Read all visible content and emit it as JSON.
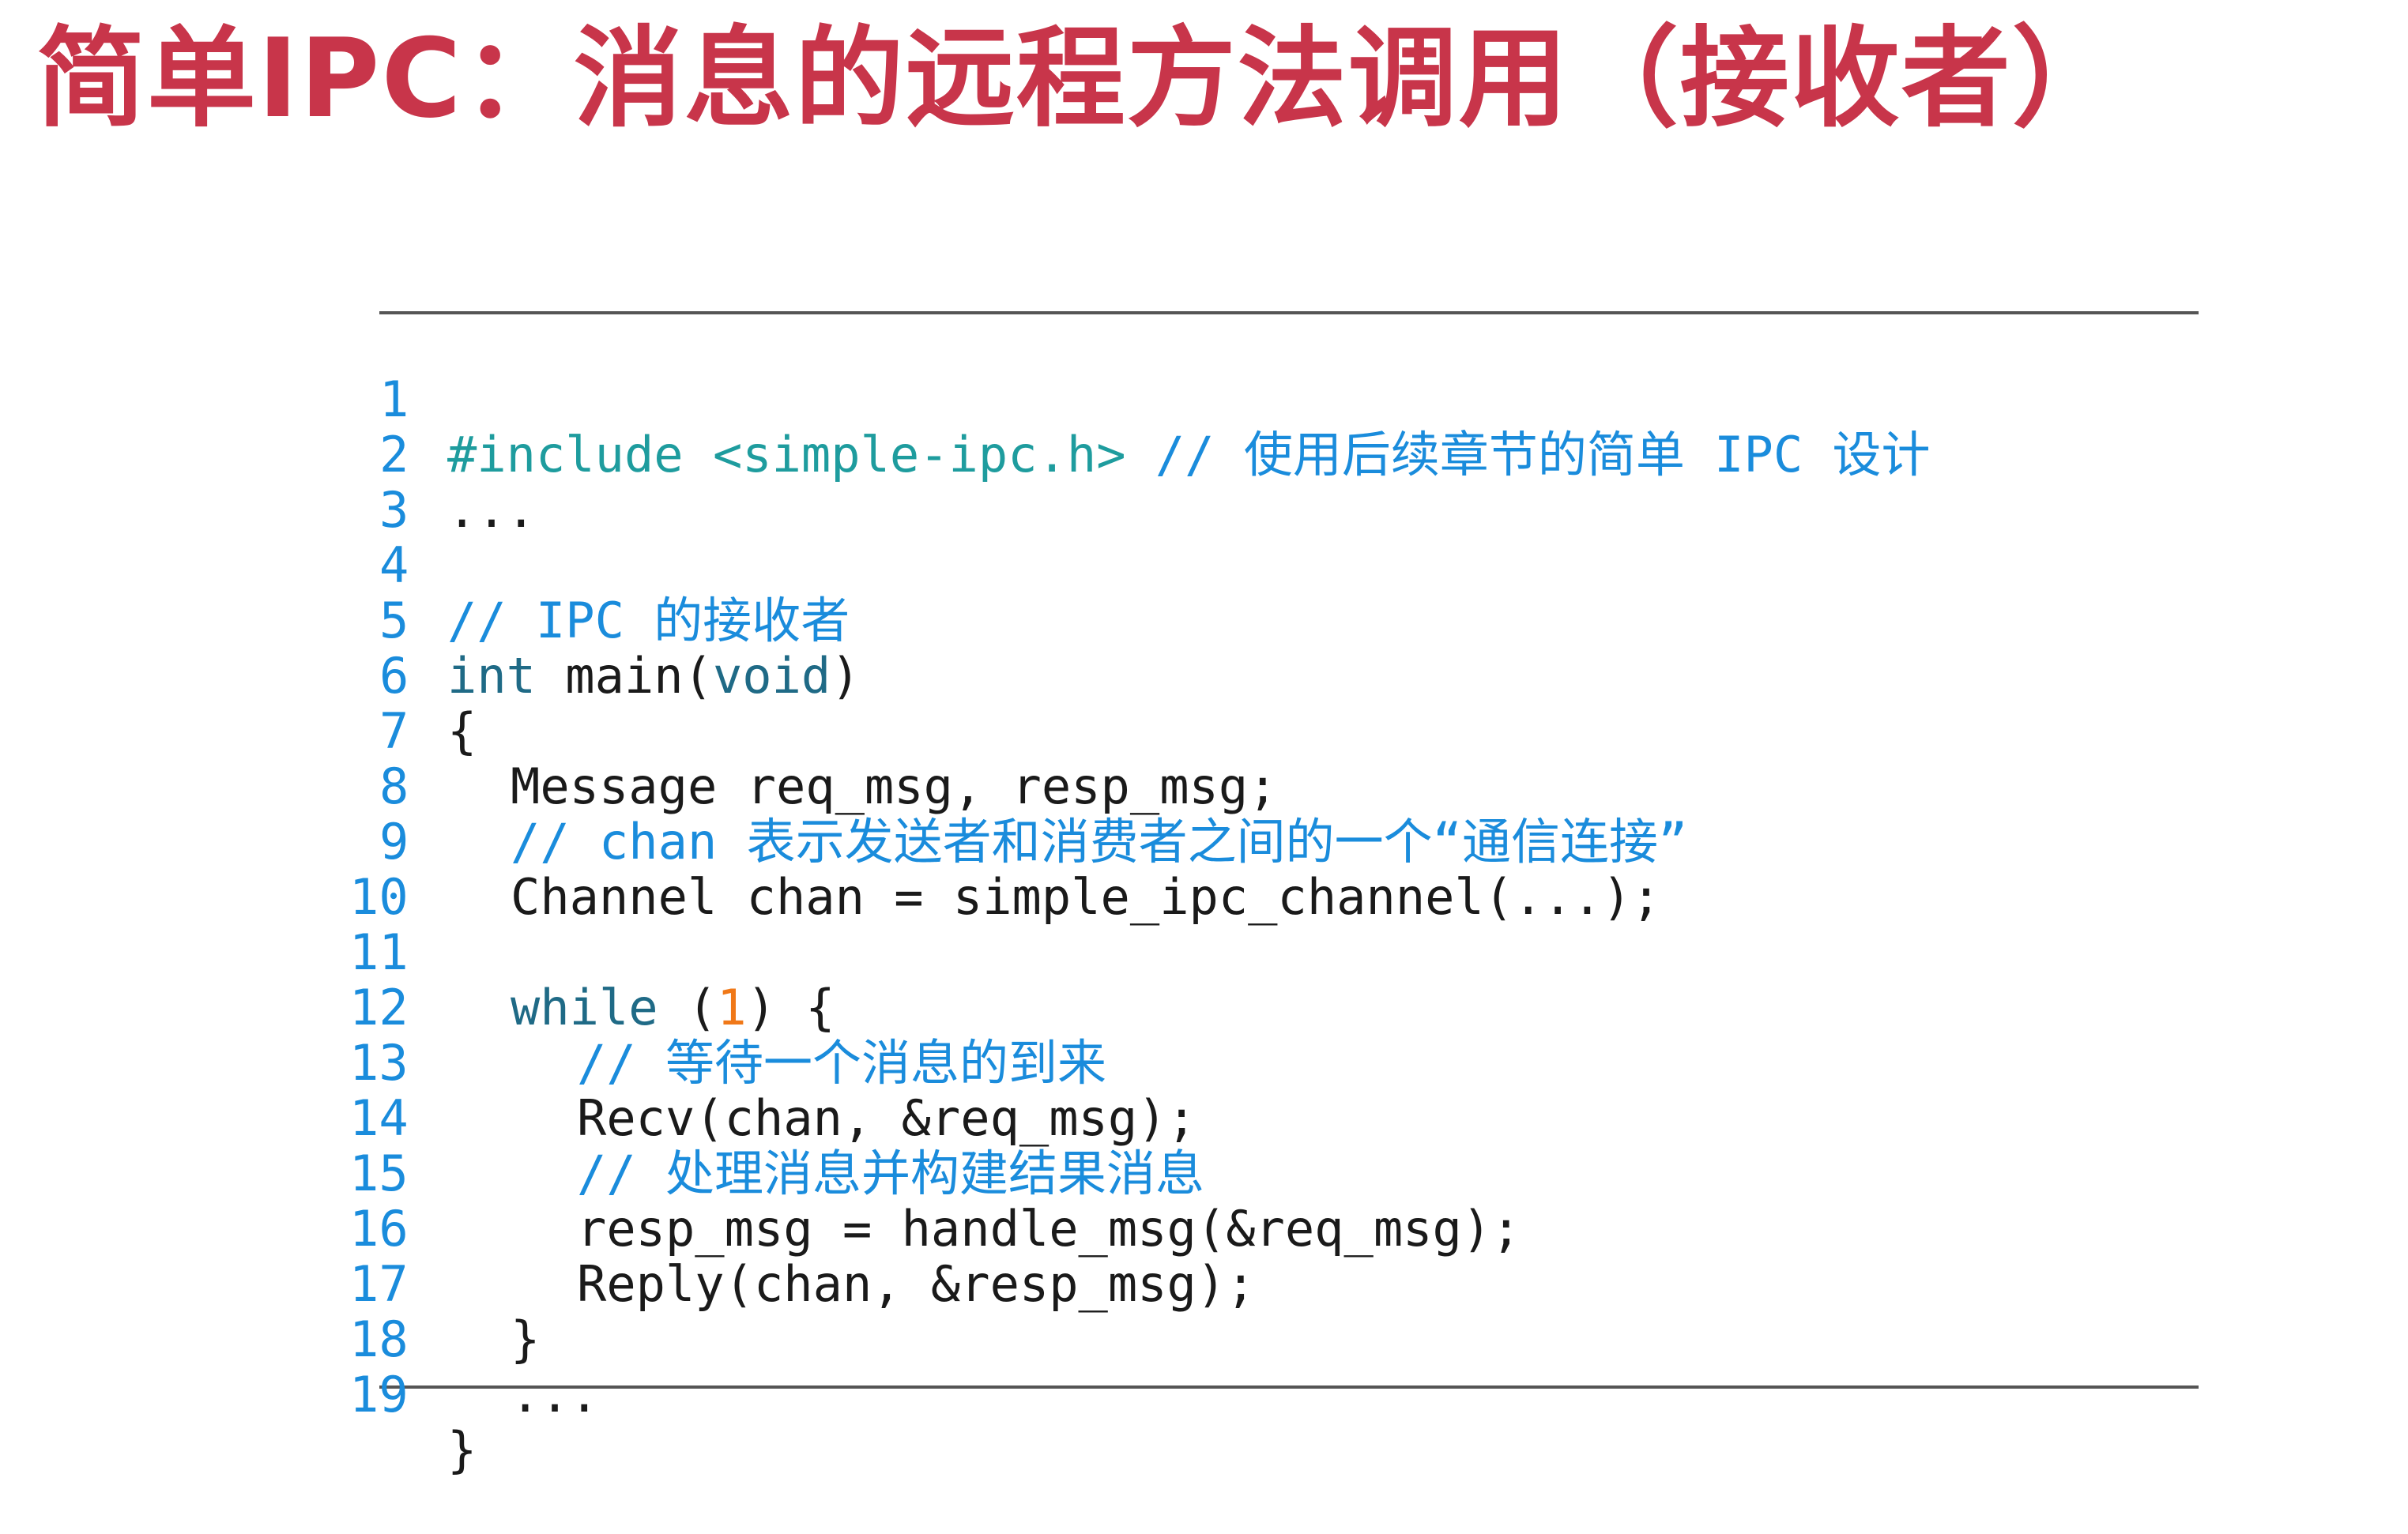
{
  "slide": {
    "title": "简单IPC：消息的远程方法调用（接收者）"
  },
  "code": {
    "lines": [
      {
        "no": "1",
        "parts": [
          "#include <simple-ipc.h>",
          " ",
          "// 使用后续章节的简单 IPC 设计"
        ]
      },
      {
        "no": "2",
        "parts": [
          "..."
        ]
      },
      {
        "no": "3",
        "parts": []
      },
      {
        "no": "4",
        "parts": [
          "// IPC 的接收者"
        ]
      },
      {
        "no": "5",
        "parts": [
          "int",
          " main(",
          "void",
          ")"
        ]
      },
      {
        "no": "6",
        "parts": [
          "{"
        ]
      },
      {
        "no": "7",
        "parts": [
          "Message req_msg, resp_msg;"
        ]
      },
      {
        "no": "8",
        "parts": [
          "// chan 表示发送者和消费者之间的一个“通信连接”"
        ]
      },
      {
        "no": "9",
        "parts": [
          "Channel chan = simple_ipc_channel(...);"
        ]
      },
      {
        "no": "10",
        "parts": []
      },
      {
        "no": "11",
        "parts": [
          "while",
          " (",
          "1",
          ") {"
        ]
      },
      {
        "no": "12",
        "parts": [
          "// 等待一个消息的到来"
        ]
      },
      {
        "no": "13",
        "parts": [
          "Recv(chan, &req_msg);"
        ]
      },
      {
        "no": "14",
        "parts": [
          "// 处理消息并构建结果消息"
        ]
      },
      {
        "no": "15",
        "parts": [
          "resp_msg = handle_msg(&req_msg);"
        ]
      },
      {
        "no": "16",
        "parts": [
          "Reply(chan, &resp_msg);"
        ]
      },
      {
        "no": "17",
        "parts": [
          "}"
        ]
      },
      {
        "no": "18",
        "parts": [
          "..."
        ]
      },
      {
        "no": "19",
        "parts": [
          "}"
        ]
      }
    ]
  },
  "colors": {
    "title": "#c8354a",
    "comment": "#1a8cdc",
    "keyword": "#1f6a86",
    "preprocessor": "#1e9c9e",
    "number": "#f07818",
    "text": "#1a1a1a",
    "line_number": "#1a8cdc"
  }
}
